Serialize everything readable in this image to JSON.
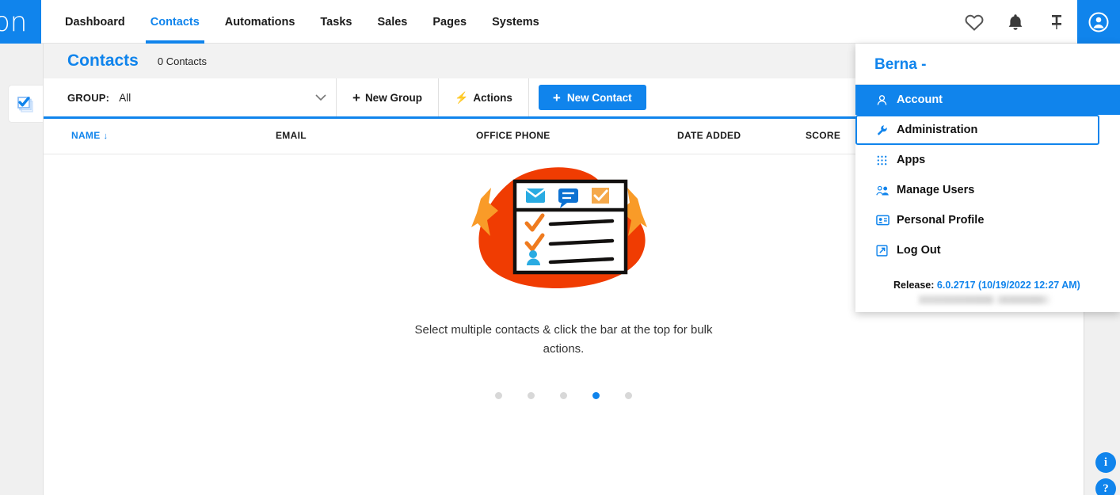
{
  "brand": {
    "logo_text": "on",
    "accent": "#1084ec"
  },
  "topnav": {
    "items": [
      {
        "label": "Dashboard",
        "active": false
      },
      {
        "label": "Contacts",
        "active": true
      },
      {
        "label": "Automations",
        "active": false
      },
      {
        "label": "Tasks",
        "active": false
      },
      {
        "label": "Sales",
        "active": false
      },
      {
        "label": "Pages",
        "active": false
      },
      {
        "label": "Systems",
        "active": false
      }
    ],
    "icons": [
      "heart-icon",
      "bell-icon",
      "pin-icon",
      "account-avatar-icon"
    ]
  },
  "page": {
    "title": "Contacts",
    "count_label": "0 Contacts"
  },
  "toolbar": {
    "group_label": "GROUP:",
    "group_value": "All",
    "chevron": "chevron-down-icon",
    "new_group_label": "New Group",
    "actions_label": "Actions",
    "new_contact_label": "New Contact",
    "plus": "+",
    "bolt": "⚡"
  },
  "table": {
    "columns": [
      {
        "label": "NAME",
        "sorted": true,
        "sort_arrow": "↓"
      },
      {
        "label": "EMAIL",
        "sorted": false
      },
      {
        "label": "OFFICE PHONE",
        "sorted": false
      },
      {
        "label": "DATE ADDED",
        "sorted": false
      },
      {
        "label": "SCORE",
        "sorted": false
      }
    ]
  },
  "empty_state": {
    "message_line1": "Select multiple contacts & click the bar at the top for",
    "message_line2": "bulk actions.",
    "message_full": "Select multiple contacts & click the bar at the top for bulk actions.",
    "carousel": {
      "total": 5,
      "active_index": 3
    }
  },
  "account_menu": {
    "user_name": "Berna -",
    "items": [
      {
        "label": "Account",
        "icon": "person-icon",
        "state": "active"
      },
      {
        "label": "Administration",
        "icon": "wrench-icon",
        "state": "focused"
      },
      {
        "label": "Apps",
        "icon": "grid-dots-icon",
        "state": "normal"
      },
      {
        "label": "Manage Users",
        "icon": "people-icon",
        "state": "normal"
      },
      {
        "label": "Personal Profile",
        "icon": "id-card-icon",
        "state": "normal"
      },
      {
        "label": "Log Out",
        "icon": "external-link-icon",
        "state": "normal"
      }
    ],
    "release_label": "Release:",
    "release_value": "6.0.2717 (10/19/2022 12:27 AM)"
  },
  "rails": {
    "left_tile_icon": "stacked-check-icon",
    "info_icon": "i",
    "help_icon": "?"
  }
}
